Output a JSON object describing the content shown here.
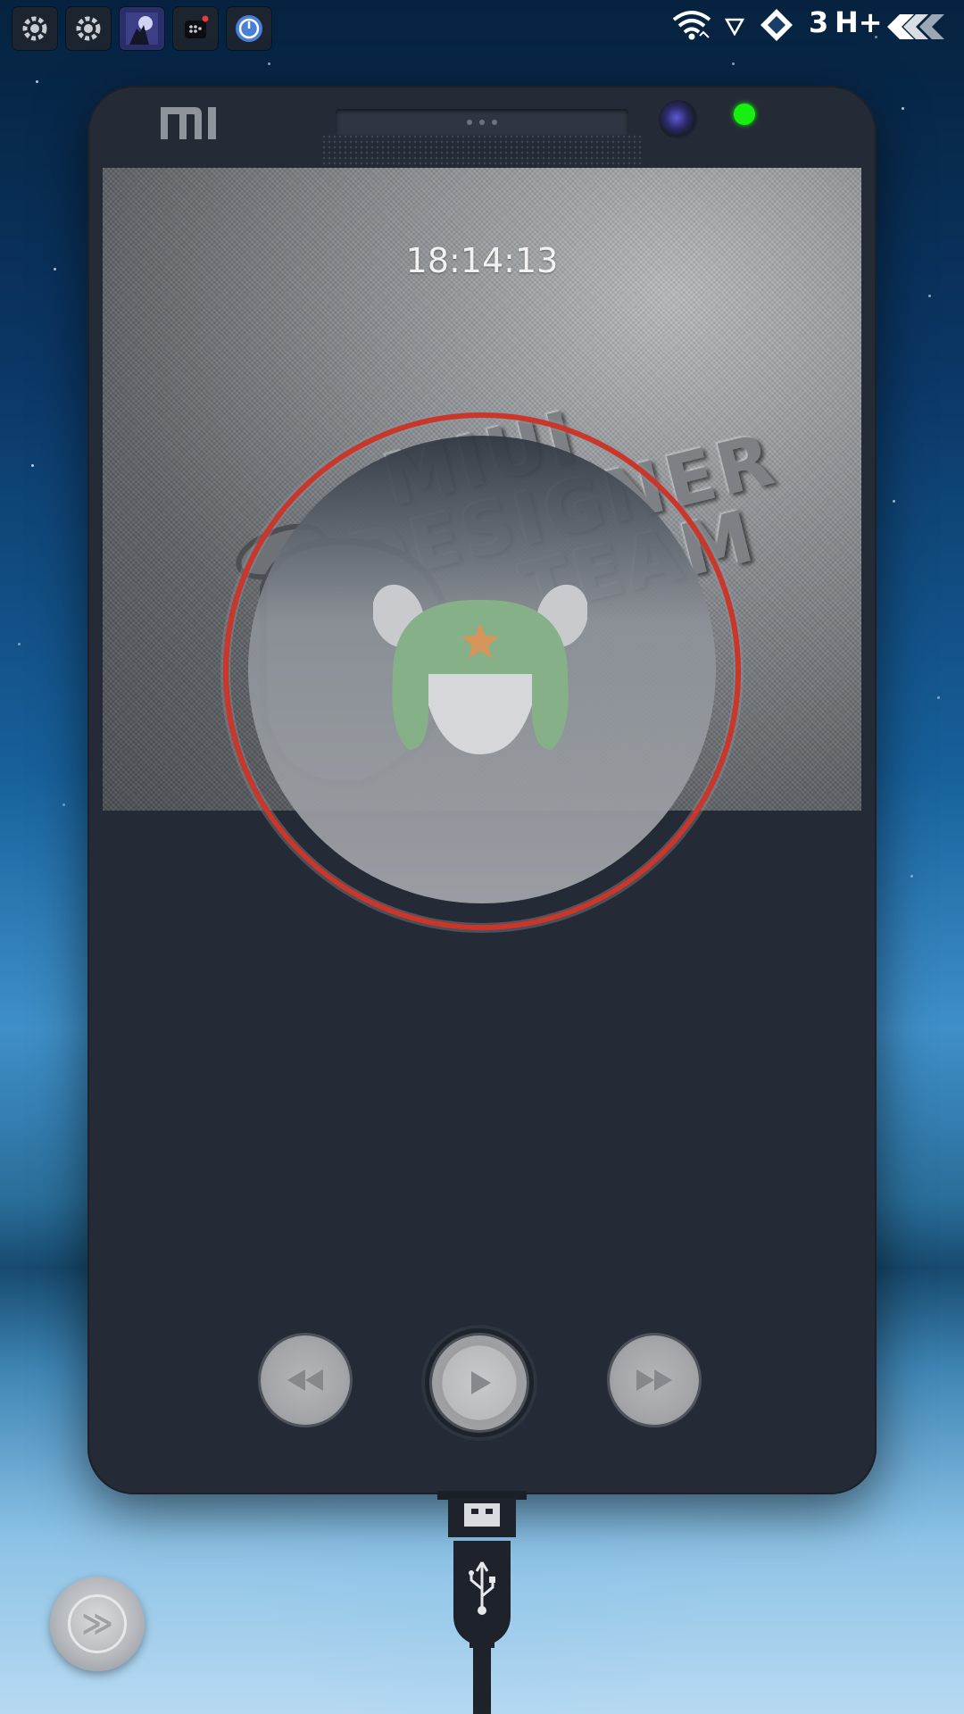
{
  "status_bar": {
    "network_label": "3",
    "network_type": "H+",
    "notification_icons": [
      "settings-gear-icon",
      "settings-gear-icon",
      "wolf-moon-app-icon",
      "bbm-messenger-icon",
      "speedometer-app-icon"
    ]
  },
  "device_skin": {
    "brand_logo": "MI",
    "led_color": "#17ef11"
  },
  "lockscreen": {
    "time": "18:14:13",
    "wallpaper_text": [
      "MIUI",
      "DESIGNER",
      "TEAM"
    ]
  },
  "music_player": {
    "album_ring_color": "#c8372a",
    "controls": [
      "previous",
      "play",
      "next"
    ]
  },
  "quick_button": {
    "glyph": "≫"
  }
}
